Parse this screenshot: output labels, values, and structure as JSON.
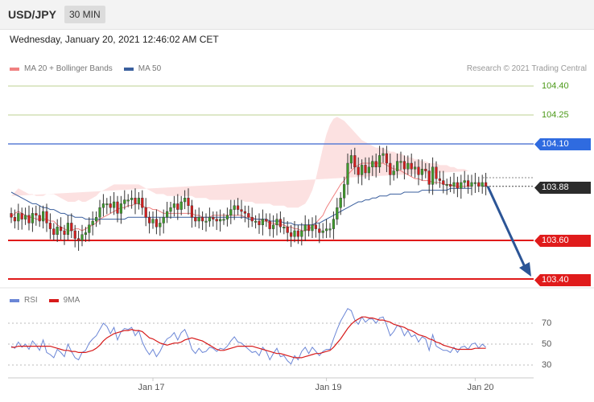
{
  "header": {
    "symbol": "USD/JPY",
    "timeframe": "30 MIN"
  },
  "timestamp": "Wednesday, January 20, 2021 12:46:02 AM CET",
  "copyright": "Research © 2021 Trading Central",
  "colors": {
    "bollinger": "#f08080",
    "ma50": "#3a5f9e",
    "resistance_green": "#c9d9a6",
    "resistance_blue": "#5b7ed6",
    "support_red": "#e01b1b",
    "rsi": "#6b86d6",
    "rsi_ma": "#d71b1b",
    "arrow": "#2c5596",
    "candle_up": "#3f9a2c",
    "candle_down": "#d11f1f"
  },
  "chart_data": [
    {
      "type": "candlestick",
      "legend": [
        {
          "name": "MA 20 + Bollinger Bands",
          "color": "#f08080"
        },
        {
          "name": "MA 50",
          "color": "#3a5f9e"
        }
      ],
      "ylim": [
        103.4,
        104.4
      ],
      "x_ticks": [
        {
          "label": "Jan 17",
          "index": 40
        },
        {
          "label": "Jan 19",
          "index": 89
        },
        {
          "label": "Jan 20",
          "index": 131
        }
      ],
      "levels": [
        {
          "value": 104.4,
          "label": "104.40",
          "style": "resistance-green"
        },
        {
          "value": 104.25,
          "label": "104.25",
          "style": "resistance-green"
        },
        {
          "value": 104.1,
          "label": "104.10",
          "style": "resistance-blue"
        },
        {
          "value": 103.88,
          "label": "103.88",
          "style": "current"
        },
        {
          "value": 103.6,
          "label": "103.60",
          "style": "support-red"
        },
        {
          "value": 103.4,
          "label": "103.40",
          "style": "support-red"
        }
      ],
      "target_arrow": {
        "from": 103.88,
        "to": 103.4
      },
      "close": [
        103.72,
        103.7,
        103.74,
        103.71,
        103.73,
        103.69,
        103.74,
        103.73,
        103.7,
        103.75,
        103.69,
        103.66,
        103.63,
        103.67,
        103.65,
        103.63,
        103.69,
        103.65,
        103.61,
        103.6,
        103.63,
        103.64,
        103.68,
        103.7,
        103.72,
        103.77,
        103.79,
        103.79,
        103.77,
        103.8,
        103.74,
        103.79,
        103.81,
        103.81,
        103.82,
        103.79,
        103.82,
        103.77,
        103.72,
        103.69,
        103.71,
        103.67,
        103.69,
        103.72,
        103.75,
        103.77,
        103.79,
        103.76,
        103.8,
        103.82,
        103.78,
        103.72,
        103.7,
        103.72,
        103.7,
        103.7,
        103.72,
        103.71,
        103.7,
        103.71,
        103.71,
        103.73,
        103.76,
        103.78,
        103.76,
        103.75,
        103.74,
        103.72,
        103.7,
        103.7,
        103.68,
        103.71,
        103.7,
        103.66,
        103.68,
        103.71,
        103.67,
        103.67,
        103.64,
        103.62,
        103.65,
        103.62,
        103.65,
        103.68,
        103.65,
        103.68,
        103.66,
        103.64,
        103.65,
        103.66,
        103.66,
        103.71,
        103.77,
        103.82,
        103.89,
        104.0,
        104.04,
        103.98,
        103.94,
        103.99,
        103.95,
        103.98,
        104.01,
        103.98,
        104.04,
        104.05,
        104.0,
        103.94,
        103.96,
        104.01,
        104.01,
        103.97,
        104.0,
        103.97,
        103.98,
        103.94,
        103.97,
        103.96,
        103.89,
        103.98,
        103.92,
        103.91,
        103.89,
        103.89,
        103.88,
        103.9,
        103.87,
        103.9,
        103.91,
        103.88,
        103.9,
        103.9,
        103.88,
        103.9,
        103.88
      ],
      "ma20": [
        103.72,
        103.74,
        103.75,
        103.74,
        103.73,
        103.72,
        103.72,
        103.71,
        103.71,
        103.71,
        103.71,
        103.7,
        103.7,
        103.68,
        103.67,
        103.66,
        103.65,
        103.65,
        103.66,
        103.66,
        103.65,
        103.66,
        103.67,
        103.68,
        103.69,
        103.71,
        103.72,
        103.73,
        103.74,
        103.75,
        103.76,
        103.77,
        103.77,
        103.78,
        103.78,
        103.79,
        103.79,
        103.78,
        103.77,
        103.77,
        103.76,
        103.76,
        103.75,
        103.74,
        103.74,
        103.74,
        103.74,
        103.74,
        103.74,
        103.74,
        103.74,
        103.74,
        103.73,
        103.73,
        103.72,
        103.72,
        103.72,
        103.73,
        103.73,
        103.73,
        103.73,
        103.73,
        103.73,
        103.73,
        103.73,
        103.73,
        103.72,
        103.72,
        103.72,
        103.71,
        103.71,
        103.7,
        103.7,
        103.69,
        103.69,
        103.68,
        103.68,
        103.68,
        103.67,
        103.67,
        103.66,
        103.66,
        103.65,
        103.65,
        103.66,
        103.67,
        103.69,
        103.71,
        103.73,
        103.77,
        103.8,
        103.83,
        103.86,
        103.89,
        103.91,
        103.94,
        103.96,
        103.98,
        103.99,
        104.0,
        104.0,
        104.0,
        104.0,
        104.0,
        104.0,
        104.0,
        103.99,
        103.98,
        103.97,
        103.97,
        103.96,
        103.95,
        103.94,
        103.93,
        103.92,
        103.92,
        103.91,
        103.91,
        103.91,
        103.9,
        103.9,
        103.9,
        103.89,
        103.89,
        103.89,
        103.88,
        103.88,
        103.88,
        103.88,
        103.88,
        103.88
      ],
      "bb_upper": [
        103.83,
        103.85,
        103.87,
        103.86,
        103.85,
        103.84,
        103.84,
        103.83,
        103.83,
        103.83,
        103.84,
        103.84,
        103.84,
        103.83,
        103.82,
        103.81,
        103.8,
        103.8,
        103.8,
        103.81,
        103.8,
        103.8,
        103.81,
        103.82,
        103.83,
        103.85,
        103.86,
        103.87,
        103.88,
        103.89,
        103.89,
        103.89,
        103.89,
        103.89,
        103.89,
        103.89,
        103.89,
        103.88,
        103.87,
        103.86,
        103.85,
        103.84,
        103.84,
        103.84,
        103.83,
        103.83,
        103.83,
        103.83,
        103.83,
        103.83,
        103.83,
        103.83,
        103.82,
        103.82,
        103.82,
        103.82,
        103.81,
        103.81,
        103.81,
        103.81,
        103.81,
        103.81,
        103.81,
        103.81,
        103.81,
        103.81,
        103.8,
        103.8,
        103.8,
        103.79,
        103.79,
        103.79,
        103.79,
        103.79,
        103.78,
        103.78,
        103.78,
        103.78,
        103.77,
        103.77,
        103.77,
        103.77,
        103.78,
        103.79,
        103.82,
        103.86,
        103.92,
        104.0,
        104.08,
        104.15,
        104.2,
        104.23,
        104.24,
        104.23,
        104.22,
        104.2,
        104.18,
        104.16,
        104.14,
        104.12,
        104.11,
        104.1,
        104.09,
        104.08,
        104.08,
        104.08,
        104.07,
        104.06,
        104.06,
        104.05,
        104.05,
        104.04,
        104.03,
        104.03,
        104.02,
        104.02,
        104.01,
        104.01,
        104.0,
        104.0,
        104.0,
        103.99,
        103.99,
        103.99,
        103.98,
        103.98,
        103.97,
        103.97,
        103.97,
        103.96,
        103.96
      ],
      "bb_lower": [
        103.61,
        103.63,
        103.63,
        103.62,
        103.61,
        103.6,
        103.6,
        103.59,
        103.59,
        103.59,
        103.58,
        103.56,
        103.56,
        103.53,
        103.52,
        103.51,
        103.5,
        103.5,
        103.52,
        103.51,
        103.5,
        103.52,
        103.53,
        103.54,
        103.55,
        103.57,
        103.58,
        103.59,
        103.6,
        103.61,
        103.63,
        103.65,
        103.65,
        103.67,
        103.67,
        103.69,
        103.69,
        103.68,
        103.67,
        103.68,
        103.67,
        103.68,
        103.66,
        103.64,
        103.65,
        103.65,
        103.65,
        103.65,
        103.65,
        103.65,
        103.65,
        103.65,
        103.64,
        103.64,
        103.62,
        103.62,
        103.63,
        103.65,
        103.65,
        103.65,
        103.65,
        103.65,
        103.65,
        103.65,
        103.65,
        103.65,
        103.64,
        103.64,
        103.64,
        103.63,
        103.63,
        103.61,
        103.61,
        103.59,
        103.6,
        103.58,
        103.58,
        103.58,
        103.57,
        103.57,
        103.55,
        103.55,
        103.52,
        103.51,
        103.5,
        103.48,
        103.46,
        103.42,
        103.38,
        103.39,
        103.4,
        103.43,
        103.48,
        103.55,
        103.6,
        103.68,
        103.74,
        103.8,
        103.84,
        103.88,
        103.89,
        103.9,
        103.91,
        103.92,
        103.92,
        103.92,
        103.91,
        103.9,
        103.88,
        103.89,
        103.87,
        103.86,
        103.85,
        103.83,
        103.82,
        103.82,
        103.81,
        103.81,
        103.82,
        103.81,
        103.81,
        103.81,
        103.8,
        103.8,
        103.81,
        103.79,
        103.79,
        103.79,
        103.79,
        103.8,
        103.8
      ],
      "ma50": [
        103.85,
        103.84,
        103.83,
        103.82,
        103.81,
        103.8,
        103.79,
        103.79,
        103.78,
        103.77,
        103.77,
        103.76,
        103.76,
        103.75,
        103.74,
        103.74,
        103.73,
        103.73,
        103.72,
        103.72,
        103.72,
        103.71,
        103.71,
        103.71,
        103.71,
        103.71,
        103.71,
        103.71,
        103.71,
        103.71,
        103.71,
        103.71,
        103.71,
        103.72,
        103.72,
        103.72,
        103.72,
        103.72,
        103.72,
        103.72,
        103.72,
        103.72,
        103.72,
        103.72,
        103.72,
        103.72,
        103.72,
        103.72,
        103.72,
        103.72,
        103.72,
        103.72,
        103.72,
        103.72,
        103.72,
        103.72,
        103.72,
        103.72,
        103.72,
        103.72,
        103.72,
        103.72,
        103.72,
        103.72,
        103.72,
        103.72,
        103.72,
        103.71,
        103.71,
        103.71,
        103.71,
        103.71,
        103.71,
        103.7,
        103.7,
        103.7,
        103.7,
        103.69,
        103.69,
        103.69,
        103.68,
        103.68,
        103.68,
        103.68,
        103.68,
        103.68,
        103.69,
        103.69,
        103.7,
        103.71,
        103.72,
        103.73,
        103.74,
        103.75,
        103.76,
        103.77,
        103.78,
        103.79,
        103.8,
        103.8,
        103.81,
        103.81,
        103.82,
        103.82,
        103.83,
        103.83,
        103.83,
        103.84,
        103.84,
        103.84,
        103.84,
        103.85,
        103.85,
        103.85,
        103.85,
        103.85,
        103.86,
        103.86,
        103.86,
        103.86,
        103.86,
        103.86,
        103.86,
        103.86,
        103.87,
        103.87,
        103.87,
        103.87,
        103.87,
        103.87,
        103.87
      ]
    },
    {
      "type": "line",
      "legend": [
        {
          "name": "RSI",
          "color": "#6b86d6"
        },
        {
          "name": "9MA",
          "color": "#d71b1b"
        }
      ],
      "ylim": [
        25,
        85
      ],
      "y_ticks": [
        70,
        50,
        30
      ],
      "x_ticks": [
        {
          "label": "Jan 17",
          "index": 40
        },
        {
          "label": "Jan 19",
          "index": 89
        },
        {
          "label": "Jan 20",
          "index": 131
        }
      ],
      "rsi": [
        48,
        46,
        52,
        47,
        50,
        45,
        53,
        49,
        44,
        54,
        42,
        40,
        37,
        45,
        42,
        38,
        50,
        43,
        37,
        35,
        42,
        44,
        51,
        55,
        58,
        64,
        70,
        67,
        60,
        66,
        54,
        62,
        65,
        64,
        66,
        58,
        63,
        52,
        45,
        40,
        45,
        38,
        43,
        50,
        55,
        57,
        61,
        54,
        61,
        64,
        56,
        45,
        41,
        46,
        42,
        43,
        47,
        46,
        43,
        46,
        45,
        48,
        53,
        57,
        52,
        51,
        48,
        45,
        42,
        43,
        39,
        47,
        43,
        35,
        41,
        46,
        38,
        39,
        34,
        31,
        39,
        35,
        43,
        47,
        41,
        47,
        43,
        39,
        43,
        45,
        45,
        55,
        64,
        72,
        78,
        84,
        82,
        73,
        69,
        76,
        71,
        74,
        74,
        70,
        75,
        76,
        68,
        58,
        62,
        68,
        66,
        58,
        63,
        57,
        59,
        52,
        57,
        55,
        44,
        59,
        48,
        46,
        44,
        44,
        42,
        47,
        42,
        47,
        48,
        45,
        50,
        51,
        46,
        50,
        47
      ],
      "ma9": [
        47,
        47,
        48,
        48,
        48,
        48,
        48,
        48,
        48,
        48,
        48,
        48,
        47,
        46,
        45,
        44,
        44,
        43,
        43,
        42,
        42,
        42,
        43,
        44,
        46,
        49,
        53,
        56,
        58,
        60,
        61,
        62,
        63,
        63,
        64,
        63,
        63,
        62,
        59,
        56,
        55,
        53,
        51,
        50,
        49,
        50,
        51,
        51,
        52,
        54,
        55,
        56,
        55,
        54,
        53,
        51,
        49,
        47,
        45,
        44,
        44,
        45,
        46,
        47,
        48,
        48,
        48,
        48,
        48,
        47,
        46,
        45,
        44,
        43,
        42,
        41,
        41,
        40,
        39,
        38,
        37,
        37,
        37,
        38,
        39,
        40,
        41,
        41,
        42,
        43,
        44,
        47,
        51,
        55,
        60,
        65,
        69,
        72,
        74,
        76,
        76,
        75,
        75,
        74,
        73,
        73,
        72,
        71,
        69,
        68,
        67,
        66,
        64,
        63,
        61,
        59,
        58,
        57,
        55,
        54,
        52,
        51,
        49,
        48,
        47,
        46,
        45,
        45,
        45,
        45,
        45,
        46,
        46,
        46,
        46
      ]
    }
  ]
}
